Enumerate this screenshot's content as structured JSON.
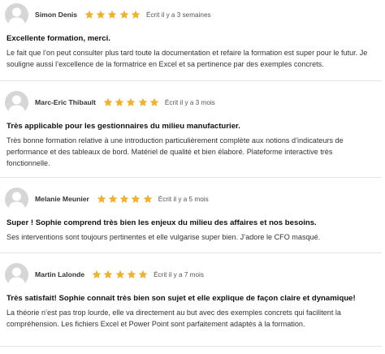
{
  "reviews": [
    {
      "author": "Simon Denis",
      "rating": 5,
      "written": "Écrit il y a 3 semaines",
      "title": "Excellente formation, merci.",
      "body": "Le fait que l’on peut consulter plus tard toute la documentation et refaire la formation est super pour le futur. Je souligne aussi l’excellence de la formatrice en Excel et sa pertinence par des exemples concrets."
    },
    {
      "author": "Marc-Eric Thibault",
      "rating": 5,
      "written": "Écrit il y a 3 mois",
      "title": "Très applicable pour les gestionnaires du milieu manufacturier.",
      "body": "Très bonne formation relative à une introduction particulièrement complète aux notions d’indicateurs de performance et des tableaux de bord. Matériel de qualité et bien élaboré. Plateforme interactive très fonctionnelle."
    },
    {
      "author": "Melanie Meunier",
      "rating": 5,
      "written": "Écrit il y a 5 mois",
      "title": "Super ! Sophie comprend très bien les enjeux du milieu des affaires et nos besoins.",
      "body": "Ses interventions sont toujours pertinentes et elle vulgarise super bien. J’adore le CFO masqué."
    },
    {
      "author": "Martin Lalonde",
      "rating": 5,
      "written": "Écrit il y a 7 mois",
      "title": "Très satisfait! Sophie connait très bien son sujet et elle explique de façon claire et dynamique!",
      "body": "La théorie n’est pas trop lourde, elle va directement au but avec des exemples concrets qui facilitent la compréhension. Les fichiers Excel et Power Point sont parfaitement adaptés à la formation."
    }
  ],
  "colors": {
    "star": "#f2b02d",
    "avatar_bg": "#d6d6d6",
    "avatar_fg": "#ffffff",
    "divider": "#e3e3e3"
  },
  "icons": {
    "avatar": "user-silhouette-icon",
    "star": "star-icon"
  }
}
